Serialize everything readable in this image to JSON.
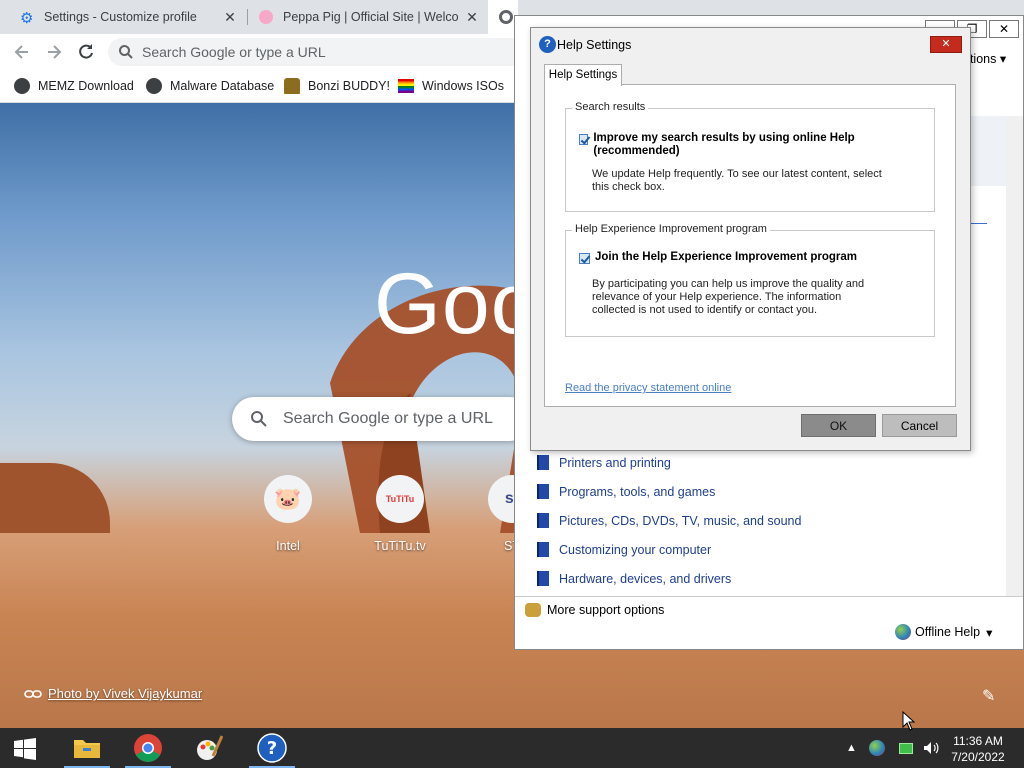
{
  "chrome": {
    "tabs": [
      {
        "title": "Settings - Customize profile",
        "close": "✕"
      },
      {
        "title": "Peppa Pig | Official Site | Welcom",
        "close": "✕"
      },
      {
        "title": "",
        "close": ""
      }
    ],
    "omnibox_placeholder": "Search Google or type a URL",
    "bookmarks": [
      {
        "label": "MEMZ Download",
        "icon": "globe-icon"
      },
      {
        "label": "Malware Database",
        "icon": "globe-icon"
      },
      {
        "label": "Bonzi BUDDY!",
        "icon": "bonzi-icon"
      },
      {
        "label": "Windows ISOs",
        "icon": "rainbow-flag-icon"
      }
    ]
  },
  "ntp": {
    "logo": "Goo",
    "search_placeholder": "Search Google or type a URL",
    "shortcuts": [
      {
        "label": "Intel",
        "glyph": "🐷"
      },
      {
        "label": "TuTiTu.tv",
        "glyph": "TuTiTu"
      },
      {
        "label": "ST",
        "glyph": "st"
      }
    ],
    "photo_credit": "Photo by Vivek Vijaykumar"
  },
  "help_support": {
    "title_buttons": [
      "_",
      "❐",
      "✕"
    ],
    "options_label": "ptions",
    "side_text": "n.",
    "topics": [
      "Printers and printing",
      "Programs, tools, and games",
      "Pictures, CDs, DVDs, TV, music, and sound",
      "Customizing your computer",
      "Hardware, devices, and drivers"
    ],
    "more_support": "More support options",
    "offline_help": "Offline Help"
  },
  "dialog": {
    "title": "Help Settings",
    "close": "✕",
    "tab": "Help Settings",
    "search_group": {
      "legend": "Search results",
      "checkbox_label": "Improve my search results by using online Help (recommended)",
      "checked": true,
      "description": "We update Help frequently. To see our latest content, select this check box."
    },
    "improve_group": {
      "legend": "Help Experience Improvement program",
      "checkbox_label": "Join the Help Experience Improvement program",
      "checked": true,
      "description": "By participating you can help us improve the quality and relevance of your Help experience. The information collected is not used to identify or contact you."
    },
    "privacy_link": "Read the privacy statement online",
    "ok": "OK",
    "cancel": "Cancel"
  },
  "taskbar": {
    "apps": [
      "file-explorer-icon",
      "chrome-icon",
      "paint-icon",
      "help-icon"
    ],
    "time": "11:36 AM",
    "date": "7/20/2022"
  }
}
